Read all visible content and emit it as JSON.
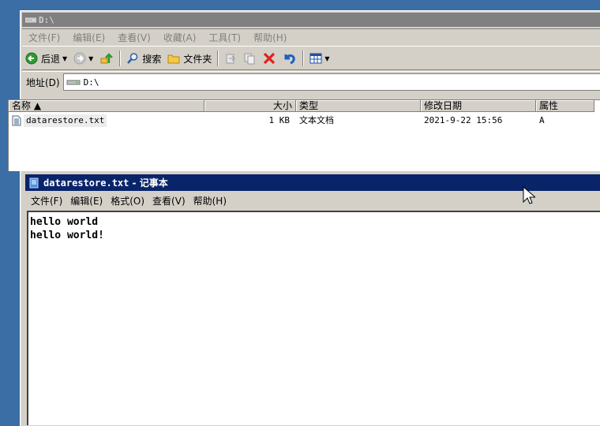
{
  "explorer": {
    "title": "D:\\",
    "menu": [
      "文件(F)",
      "编辑(E)",
      "查看(V)",
      "收藏(A)",
      "工具(T)",
      "帮助(H)"
    ],
    "toolbar": {
      "back": "后退",
      "search": "搜索",
      "folders": "文件夹"
    },
    "address": {
      "label": "地址(D)",
      "value": "D:\\"
    },
    "columns": {
      "name": "名称 ▲",
      "size": "大小",
      "type": "类型",
      "modified": "修改日期",
      "attributes": "属性"
    },
    "files": [
      {
        "name": "datarestore.txt",
        "size": "1 KB",
        "type": "文本文档",
        "modified": "2021-9-22 15:56",
        "attributes": "A"
      }
    ]
  },
  "notepad": {
    "title_file": "datarestore.txt",
    "title_app": " - 记事本",
    "menu": [
      "文件(F)",
      "编辑(E)",
      "格式(O)",
      "查看(V)",
      "帮助(H)"
    ],
    "lines": [
      "hello world",
      "hello world!"
    ]
  },
  "colors": {
    "desktop": "#3a6ea5",
    "active_title": "#0a246a",
    "inactive_title": "#808080",
    "chrome": "#d4d0c8"
  }
}
